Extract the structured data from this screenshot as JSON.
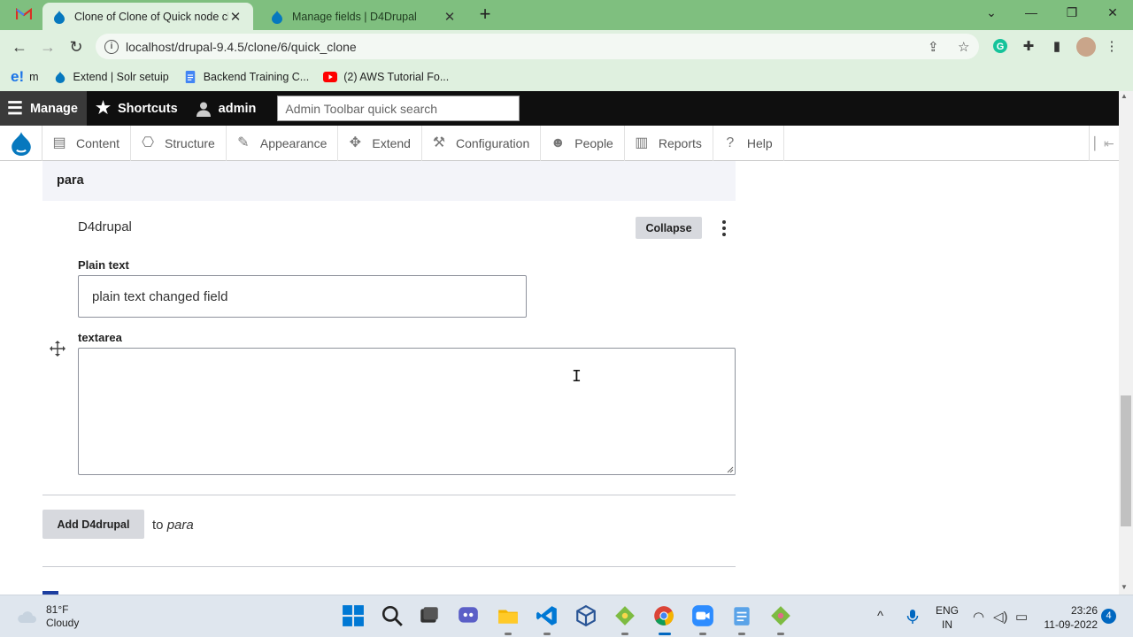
{
  "browser": {
    "tabs": [
      {
        "title": "Clone of Clone of Quick node clo",
        "active": true
      },
      {
        "title": "Manage fields | D4Drupal",
        "active": false
      }
    ],
    "url": "localhost/drupal-9.4.5/clone/6/quick_clone",
    "bookmarks": [
      {
        "label": "m",
        "icon": "email-icon"
      },
      {
        "label": "Extend | Solr setuip",
        "icon": "drupal-icon"
      },
      {
        "label": "Backend Training C...",
        "icon": "docs-icon"
      },
      {
        "label": "(2) AWS Tutorial Fo...",
        "icon": "youtube-icon"
      }
    ]
  },
  "admin_toolbar": {
    "manage": "Manage",
    "shortcuts": "Shortcuts",
    "user": "admin",
    "search_placeholder": "Admin Toolbar quick search",
    "tray": [
      "Content",
      "Structure",
      "Appearance",
      "Extend",
      "Configuration",
      "People",
      "Reports",
      "Help"
    ]
  },
  "form": {
    "section_title": "para",
    "paragraph_type": "D4drupal",
    "collapse_label": "Collapse",
    "plain_text_label": "Plain text",
    "plain_text_value": "plain text changed field",
    "textarea_label": "textarea",
    "textarea_value": "",
    "add_button": "Add D4drupal",
    "add_to_prefix": "to",
    "add_to_target": "para"
  },
  "taskbar": {
    "temperature": "81°F",
    "condition": "Cloudy",
    "lang_line1": "ENG",
    "lang_line2": "IN",
    "time": "23:26",
    "date": "11-09-2022",
    "notifications": "4"
  },
  "colors": {
    "chrome_tabstrip": "#7fbf7f",
    "chrome_toolbar": "#dff0df",
    "drupal_blue": "#0678be",
    "admin_bar": "#0f0f0f"
  }
}
